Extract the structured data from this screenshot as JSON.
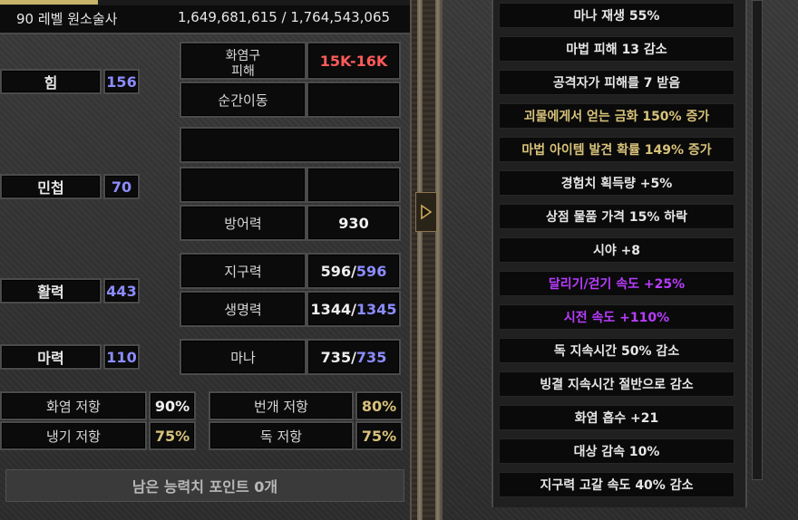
{
  "header": {
    "level_class": "90 레벨 원소술사",
    "experience": "1,649,681,615 / 1,764,543,065"
  },
  "attributes": [
    {
      "label": "힘",
      "value": "156"
    },
    {
      "label": "민첩",
      "value": "70"
    },
    {
      "label": "활력",
      "value": "443"
    },
    {
      "label": "마력",
      "value": "110"
    }
  ],
  "skill": {
    "label_line1": "화염구",
    "label_line2": "피해",
    "damage": "15K-16K",
    "secondary_label": "순간이동"
  },
  "defense": {
    "label": "방어력",
    "value": "930"
  },
  "stamina": {
    "label": "지구력",
    "current": "596",
    "max": "596",
    "sep": "/"
  },
  "life": {
    "label": "생명력",
    "current": "1344",
    "max": "1345",
    "sep": "/"
  },
  "mana": {
    "label": "마나",
    "current": "735",
    "max": "735",
    "sep": "/"
  },
  "resistances": [
    {
      "label": "화염 저항",
      "value": "90%"
    },
    {
      "label": "번개 저항",
      "value": "80%"
    },
    {
      "label": "냉기 저항",
      "value": "75%"
    },
    {
      "label": "독 저항",
      "value": "75%"
    }
  ],
  "footer": {
    "points": "남은 능력치 포인트 0개"
  },
  "toggle_icon": "triangle-right-icon",
  "stats_list": [
    {
      "text": "마나 재생 55%",
      "color": "#e6e6e6"
    },
    {
      "text": "마법 피해 13 감소",
      "color": "#e6e6e6"
    },
    {
      "text": "공격자가 피해를 7 받음",
      "color": "#e6e6e6"
    },
    {
      "text": "괴물에게서 얻는 금화 150% 증가",
      "color": "#d8c27a"
    },
    {
      "text": "마법 아이템 발견 확률 149% 증가",
      "color": "#d8c27a"
    },
    {
      "text": "경험치 획득량 +5%",
      "color": "#e6e6e6"
    },
    {
      "text": "상점 물품 가격 15% 하락",
      "color": "#e6e6e6"
    },
    {
      "text": "시야 +8",
      "color": "#e6e6e6"
    },
    {
      "text": "달리기/걷기 속도 +25%",
      "color": "#b83cff"
    },
    {
      "text": "시전 속도 +110%",
      "color": "#b83cff"
    },
    {
      "text": "독 지속시간 50% 감소",
      "color": "#e6e6e6"
    },
    {
      "text": "빙결 지속시간 절반으로 감소",
      "color": "#e6e6e6"
    },
    {
      "text": "화염 흡수 +21",
      "color": "#e6e6e6"
    },
    {
      "text": "대상 감속 10%",
      "color": "#e6e6e6"
    },
    {
      "text": "지구력 고갈 속도 40% 감소",
      "color": "#e6e6e6"
    }
  ]
}
